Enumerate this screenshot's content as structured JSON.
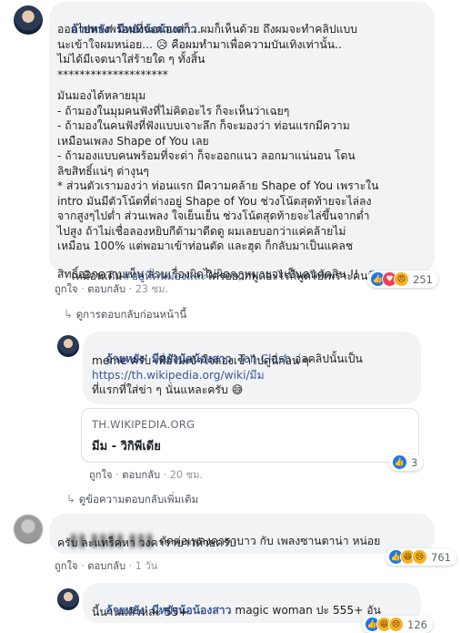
{
  "comment1": {
    "author": "อ้ายหยัง' มีหยังน้อน้องสาว",
    "lines": [
      " ผมก็เห็นด้วย ถึงผมจะทำคลิปแบบ",
      "ออกไปทางพร้อมที่จะด่าแต่ก็...",
      "นะเข้าใจผมหน่อย... 😥 คือผมทำมาเพื่อความบันเทิงเท่านั้น..",
      "ไม่ได้มีเจตนาใส่ร้ายใด ๆ ทั้งสิ้น",
      "********************",
      "มันมองได้หลายมุม",
      "- ถ้ามองในมุมคนฟังที่ไม่คิดอะไร ก็จะเห็นว่าเฉยๆ",
      "- ถ้ามองในคนฟังที่ฟังแบบเจาะลึก ก็จะมองว่า ท่อนแรกมีความ",
      "เหมือนเพลง Shape of You เลย",
      "- ถ้ามองแบบคนพร้อมที่จะด่า ก็จะออกแนว ลอกมาแน่นอน โดน",
      "ลิขสิทธิ์แน่ๆ ด่างุนๆ",
      "* ส่วนตัวเรามองว่า ท่อนแรก มีความคล้าย Shape of You เพราะใน",
      "intro มันมีตัวโน้ตที่ต่างอยู่ Shape of You ช่วงโน้ตสุดท้ายจะไล่ลง",
      "จากสูงๆไปต่ำ ส่วนเพลง ใจเย็นเย็น ช่วงโน้ตสุดท้ายจะไล่ขึ้นจากต่ำ",
      "ไปสูง ถ้าไม่เชื่อลองหยิบกีต้ามาดีดดู ผมเลยบอกว่าแค่คล้ายไม่",
      "เหมือน 100% แต่พอมาเข้าท่อนตัด และฮุด ก็กลับมาเป็นแคลช",
      "เหมือนเดิม",
      "ใครอยากพูดอะไรก็พูดไปเพราะคนมี",
      "สิทธิ์ออกความเห็น ส่วนเรื่องผิดไม่ผิดกฎหมายจะเป็นคนตัดสิน !!"
    ],
    "hashtag": "#อยู่ที่คนมองและ",
    "like_label": "ถูกใจ",
    "reply_label": "ตอบกลับ",
    "time": "23 ชม.",
    "reaction_count": "251",
    "reactions": [
      "like",
      "love",
      "haha"
    ]
  },
  "prev_replies_label": "ดูการตอบกลับก่อนหน้านี้",
  "reply1": {
    "author": "อ้ายหยัง' มีหยังน้อน้องสาว",
    "mention": "Ton Clash",
    "text_after_mention": " อ่อคลิปนั้นเป็น",
    "line2": "meme ครับ เพื่อไม่เข้าใจลองเข้าไปดูนี่ก่อน ๆ",
    "link": "https://th.wikipedia.org/wiki/มีม",
    "line4": "ที่แรกที่ใส่ข่า ๆ นั่นแหละครับ 😅",
    "card_domain": "TH.WIKIPEDIA.ORG",
    "card_title": "มีม - วิกิพีเดีย",
    "like_label": "ถูกใจ",
    "reply_label": "ตอบกลับ",
    "time": "20 ชม.",
    "reaction_count": "3"
  },
  "more_replies_label": "ดูข้อความตอบกลับเพิ่มเติม",
  "comment2": {
    "author_blurred": "▌▌ ▌▌▌▌ ▌▌▌",
    "line1": " ตัดต่อเพลงคาราบาว กับ เพลงซานตาน่า หน่อย",
    "line2": "ครับ ละแทร็คหา วงคาราบาวด้วยครับ",
    "like_label": "ถูกใจ",
    "reply_label": "ตอบกลับ",
    "time": "1 วัน",
    "reaction_count": "761"
  },
  "reply2": {
    "author": "อ้ายหยัง' มีหยังน้อน้องสาว",
    "line1": " magic woman ปะ 555+ อัน",
    "line2": "นี้นานแล้วหละ 55+",
    "reaction_count": "126"
  },
  "colors": {
    "bubble": "#f2f3f5",
    "name": "#385898",
    "like": "#1877f2",
    "love": "#f33e58",
    "haha": "#f7b125"
  }
}
